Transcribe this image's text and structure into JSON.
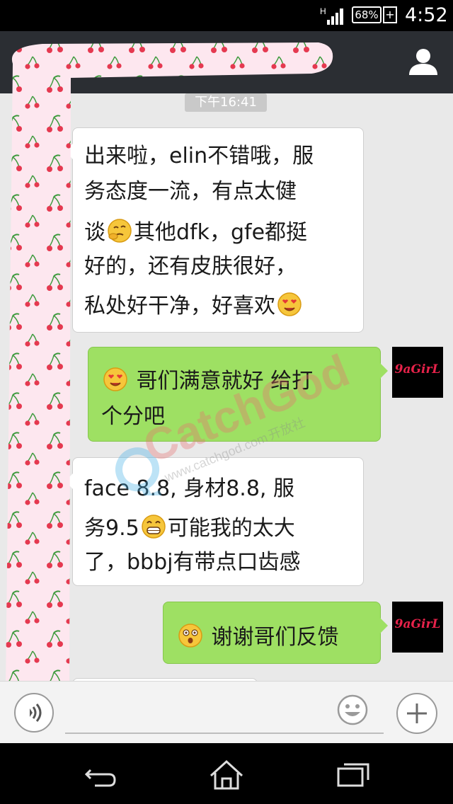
{
  "status_bar": {
    "network": "H",
    "battery": "68%",
    "time": "4:52"
  },
  "header": {
    "profile_icon": "person-icon"
  },
  "chat": {
    "timestamp": "下午16:41",
    "messages": [
      {
        "side": "in",
        "lines": [
          {
            "text": "出来啦，elin不错哦，服"
          },
          {
            "text": "务态度一流，有点太健"
          },
          {
            "text": "谈",
            "emoji": "thinking-face-icon",
            "after": "其他dfk，gfe都挺"
          },
          {
            "text": "好的，还有皮肤很好，"
          },
          {
            "text": "私处好干净，好喜欢",
            "emoji_end": "heart-eyes-face-icon"
          }
        ]
      },
      {
        "side": "out",
        "avatar_label": "9aGirL",
        "lines": [
          {
            "emoji": "heart-eyes-face-icon",
            "after": "哥们满意就好 给打"
          },
          {
            "text": "个分吧"
          }
        ]
      },
      {
        "side": "in",
        "lines": [
          {
            "text": "face 8.8, 身材8.8, 服"
          },
          {
            "text": "务9.5",
            "emoji": "grinning-face-icon",
            "after": "可能我的太大"
          },
          {
            "text": "了，bbbj有带点口齿感"
          }
        ]
      },
      {
        "side": "out",
        "avatar_label": "9aGirL",
        "lines": [
          {
            "emoji": "surprised-face-icon",
            "after": "谢谢哥们反馈"
          }
        ]
      }
    ]
  },
  "watermark": {
    "brand": "CatchGod",
    "url": "www.catchgod.com",
    "suffix": "开放社"
  },
  "input_bar": {
    "placeholder": "",
    "voice_icon": "voice-icon",
    "emoji_icon": "smiley-icon",
    "plus_icon": "plus-icon"
  },
  "nav_bar": {
    "back_icon": "back-icon",
    "home_icon": "home-icon",
    "recents_icon": "recents-icon"
  },
  "colors": {
    "out_bubble": "#9ee063",
    "in_bubble": "#ffffff",
    "chat_bg": "#e9e9e9",
    "titlebar": "#2b2e33"
  }
}
